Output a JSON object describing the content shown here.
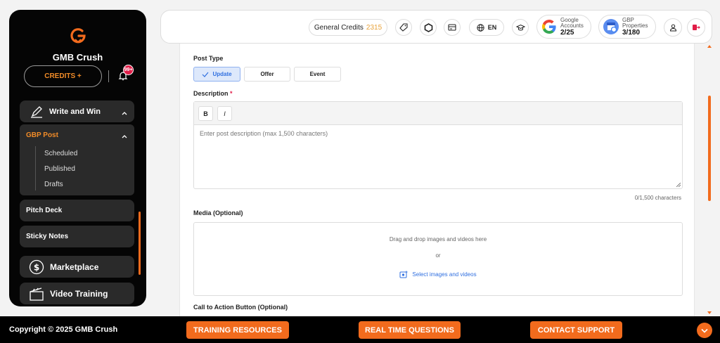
{
  "brand": {
    "name": "GMB Crush",
    "accent": "#f26b1d"
  },
  "sidebar": {
    "credits_label": "CREDITS +",
    "notification_count": "99+",
    "write_and_win": "Write and Win",
    "gbp_post": "GBP Post",
    "sub_items": [
      "Scheduled",
      "Published",
      "Drafts"
    ],
    "pitch_deck": "Pitch Deck",
    "sticky_notes": "Sticky Notes",
    "marketplace": "Marketplace",
    "video_training": "Video Training"
  },
  "header": {
    "general_credits_label": "General Credits",
    "general_credits_value": "2315",
    "language": "EN",
    "google_accounts_label_1": "Google",
    "google_accounts_label_2": "Accounts",
    "google_accounts_value": "2/25",
    "gbp_properties_label_1": "GBP",
    "gbp_properties_label_2": "Properties",
    "gbp_properties_value": "3/180"
  },
  "form": {
    "post_type_label": "Post Type",
    "post_types": [
      "Update",
      "Offer",
      "Event"
    ],
    "selected_post_type": "Update",
    "description_label": "Description",
    "required_mark": "*",
    "bold_label": "B",
    "italic_label": "I",
    "description_placeholder": "Enter post description (max 1,500 characters)",
    "char_count": "0/1,500 characters",
    "media_label": "Media (Optional)",
    "drop_text": "Drag and drop images and videos here",
    "or_text": "or",
    "select_link": "Select images and videos",
    "cta_label": "Call to Action Button (Optional)"
  },
  "footer": {
    "copyright": "Copyright © 2025 GMB Crush",
    "training": "TRAINING RESOURCES",
    "questions": "REAL TIME QUESTIONS",
    "support": "CONTACT SUPPORT"
  }
}
